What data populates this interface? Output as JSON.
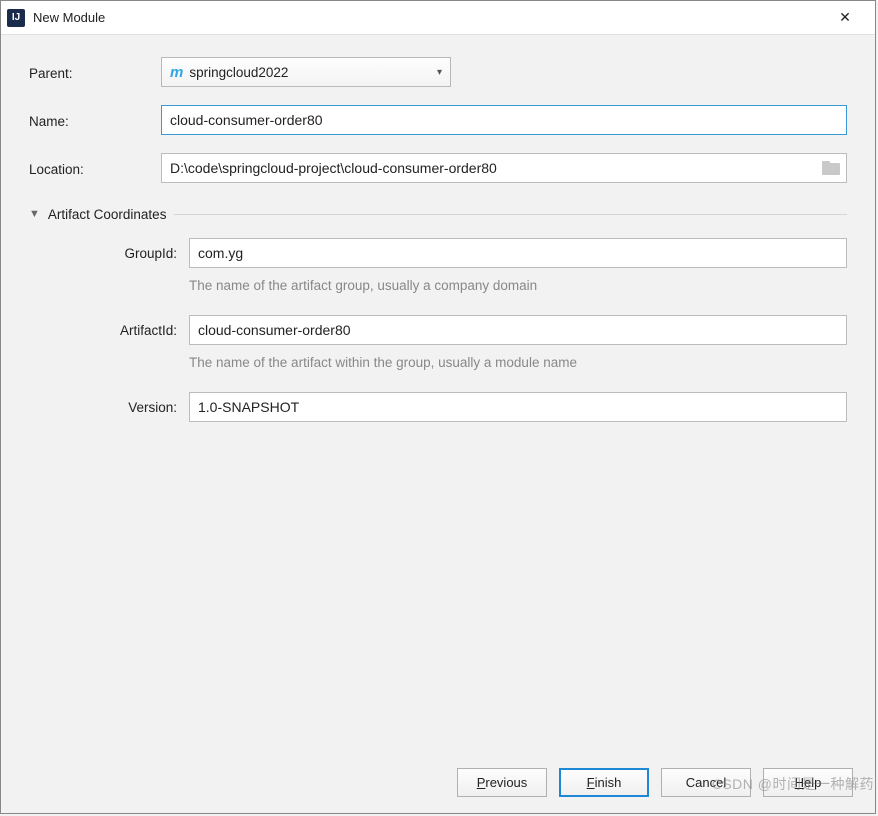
{
  "window": {
    "title": "New Module",
    "close_glyph": "✕"
  },
  "form": {
    "parent_label": "Parent:",
    "parent_value": "springcloud2022",
    "name_label": "Name:",
    "name_value": "cloud-consumer-order80",
    "location_label": "Location:",
    "location_value": "D:\\code\\springcloud-project\\cloud-consumer-order80"
  },
  "artifact": {
    "section_title": "Artifact Coordinates",
    "group_label": "GroupId:",
    "group_value": "com.yg",
    "group_hint": "The name of the artifact group, usually a company domain",
    "artifact_label": "ArtifactId:",
    "artifact_value": "cloud-consumer-order80",
    "artifact_hint": "The name of the artifact within the group, usually a module name",
    "version_label": "Version:",
    "version_value": "1.0-SNAPSHOT"
  },
  "buttons": {
    "previous": "Previous",
    "finish": "Finish",
    "cancel": "Cancel",
    "help": "Help"
  },
  "watermark": "CSDN @时间是一种解药"
}
